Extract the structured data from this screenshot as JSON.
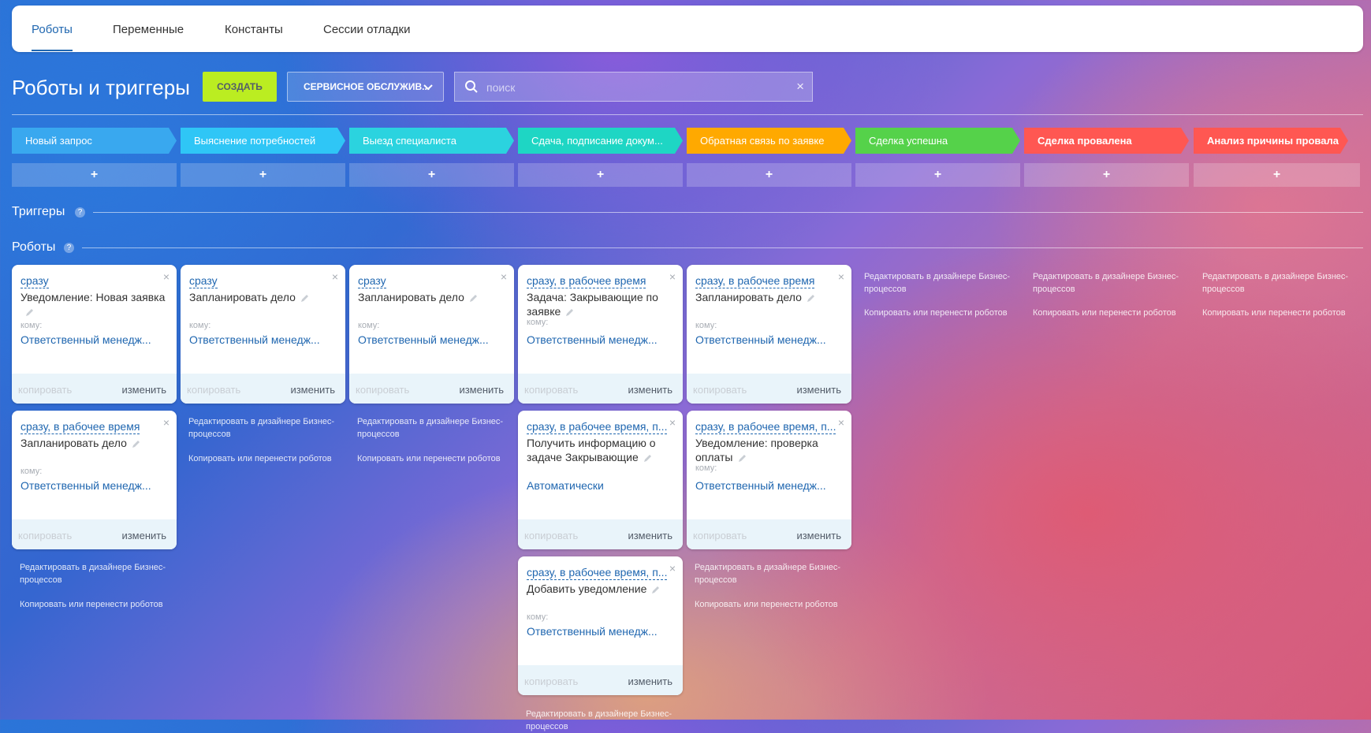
{
  "tabs": [
    "Роботы",
    "Переменные",
    "Константы",
    "Сессии отладки"
  ],
  "header": {
    "title": "Роботы и триггеры",
    "create_label": "СОЗДАТЬ",
    "category": "СЕРВИСНОЕ ОБСЛУЖИВ...",
    "search_placeholder": "поиск"
  },
  "stages": [
    {
      "name": "Новый запрос",
      "color": "#39a8ef"
    },
    {
      "name": "Выяснение потребностей",
      "color": "#2fc6f6"
    },
    {
      "name": "Выезд специалиста",
      "color": "#2bd3df"
    },
    {
      "name": "Сдача, подписание докум...",
      "color": "#1ed6c4"
    },
    {
      "name": "Обратная связь по заявке",
      "color": "#ffa900"
    },
    {
      "name": "Сделка успешна",
      "color": "#47e4c2"
    },
    {
      "name": "Сделка провалена",
      "color": "#ff5752"
    },
    {
      "name": "Анализ причины провала",
      "color": "#ff5752"
    }
  ],
  "plus": "+",
  "sections": {
    "triggers": "Триггеры",
    "robots": "Роботы",
    "help": "?"
  },
  "card_labels": {
    "to": "кому:",
    "copy": "копировать",
    "edit": "изменить",
    "close": "×"
  },
  "links": {
    "edit_designer": "Редактировать в дизайнере Бизнес-процессов",
    "copy_move": "Копировать или перенести роботов"
  },
  "robots": [
    {
      "when": "сразу",
      "name": "Уведомление: Новая заявка",
      "to_label": "кому:",
      "target": "Ответственный менедж..."
    },
    {
      "when": "сразу, в рабочее время",
      "name": "Запланировать дело",
      "to_label": "кому:",
      "target": "Ответственный менедж..."
    },
    {
      "when": "сразу",
      "name": "Запланировать дело",
      "to_label": "кому:",
      "target": "Ответственный менедж..."
    },
    {
      "when": "сразу",
      "name": "Запланировать дело",
      "to_label": "кому:",
      "target": "Ответственный менедж..."
    },
    {
      "when": "сразу, в рабочее время",
      "name": "Задача: Закрывающие по заявке",
      "to_label": "кому:",
      "target": "Ответственный менедж..."
    },
    {
      "when": "сразу, в рабочее время, п...",
      "name": "Получить информацию о задаче Закрывающие",
      "to_label": "",
      "target": "Автоматически"
    },
    {
      "when": "сразу, в рабочее время, п...",
      "name": "Добавить уведомление",
      "to_label": "кому:",
      "target": "Ответственный менедж..."
    },
    {
      "when": "сразу, в рабочее время",
      "name": "Запланировать дело",
      "to_label": "кому:",
      "target": "Ответственный менедж..."
    },
    {
      "when": "сразу, в рабочее время, п...",
      "name": "Уведомление: проверка оплаты",
      "to_label": "кому:",
      "target": "Ответственный менедж..."
    }
  ]
}
